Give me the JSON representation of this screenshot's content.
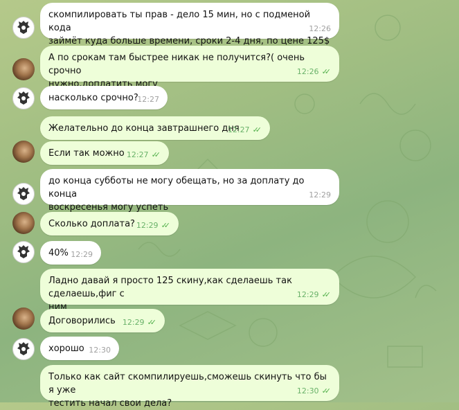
{
  "chat": {
    "messages": [
      {
        "side": "in",
        "text": "скомпилировать ты прав - дело 15 мин, но с подменой кода\nзаймёт куда больше времени, сроки 2-4 дня, по цене 125$",
        "time": "12:26",
        "avatar": "emblem"
      },
      {
        "side": "out",
        "text": "А по срокам там быстрее никак не получится?( очень срочно\nнужно,доплатить могу",
        "time": "12:26",
        "avatar": "photo"
      },
      {
        "side": "in",
        "text": "насколько срочно?",
        "time": "12:27",
        "avatar": "emblem"
      },
      {
        "side": "out",
        "text": "Желательно до конца завтрашнего дня",
        "time": "12:27",
        "avatar": ""
      },
      {
        "side": "out",
        "text": "Если так можно",
        "time": "12:27",
        "avatar": "photo"
      },
      {
        "side": "in",
        "text": "до конца субботы не могу обещать, но за доплату до конца\nвоскресенья могу успеть",
        "time": "12:29",
        "avatar": "emblem"
      },
      {
        "side": "out",
        "text": "Сколько доплата?",
        "time": "12:29",
        "avatar": "photo"
      },
      {
        "side": "in",
        "text": "40%",
        "time": "12:29",
        "avatar": "emblem"
      },
      {
        "side": "out",
        "text": "Ладно давай я просто 125 скину,как сделаешь так сделаешь,фиг с\nним",
        "time": "12:29",
        "avatar": ""
      },
      {
        "side": "out",
        "text": "Договорились",
        "time": "12:29",
        "avatar": "photo"
      },
      {
        "side": "in",
        "text": "хорошо",
        "time": "12:30",
        "avatar": "emblem"
      },
      {
        "side": "out",
        "text": "Только как сайт скомпилируешь,сможешь скинуть что бы я уже\nтестить начал свои дела?",
        "time": "12:30",
        "avatar": ""
      }
    ]
  }
}
